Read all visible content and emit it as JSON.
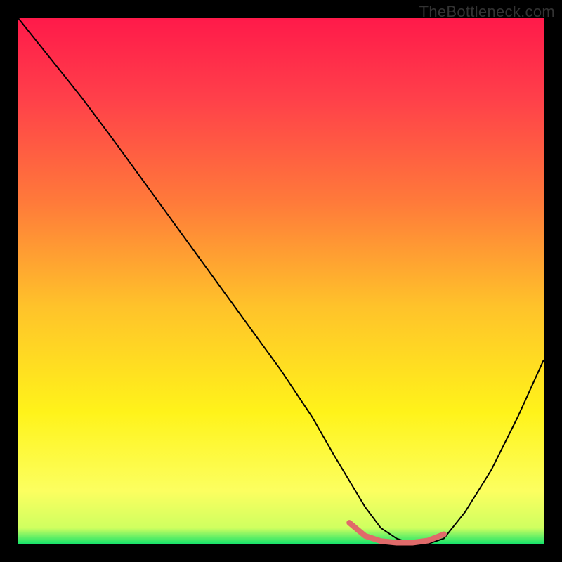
{
  "watermark": {
    "text": "TheBottleneck.com"
  },
  "gradient": {
    "stops": [
      {
        "pct": 0,
        "color": "#ff1a4a"
      },
      {
        "pct": 15,
        "color": "#ff3f4a"
      },
      {
        "pct": 35,
        "color": "#ff7a3a"
      },
      {
        "pct": 55,
        "color": "#ffc32a"
      },
      {
        "pct": 75,
        "color": "#fff31a"
      },
      {
        "pct": 90,
        "color": "#fcff60"
      },
      {
        "pct": 97,
        "color": "#cfff60"
      },
      {
        "pct": 100,
        "color": "#18e46a"
      }
    ]
  },
  "chart_data": {
    "type": "line",
    "title": "",
    "xlabel": "",
    "ylabel": "",
    "xlim": [
      0,
      100
    ],
    "ylim": [
      0,
      100
    ],
    "grid": false,
    "series": [
      {
        "name": "bottleneck-curve",
        "color": "#000000",
        "width": 2,
        "x": [
          0,
          4,
          8,
          12,
          18,
          26,
          34,
          42,
          50,
          56,
          60,
          63,
          66,
          69,
          72,
          75,
          78,
          81,
          85,
          90,
          95,
          100
        ],
        "values": [
          100,
          95,
          90,
          85,
          77,
          66,
          55,
          44,
          33,
          24,
          17,
          12,
          7,
          3,
          1,
          0,
          0,
          1,
          6,
          14,
          24,
          35
        ]
      },
      {
        "name": "optimal-band",
        "color": "#e06a6a",
        "width": 8,
        "cap": "round",
        "x": [
          63,
          66,
          69,
          72,
          75,
          78,
          81
        ],
        "values": [
          4,
          1.5,
          0.5,
          0.2,
          0.2,
          0.6,
          1.8
        ]
      }
    ],
    "legend": {
      "position": "none"
    }
  }
}
